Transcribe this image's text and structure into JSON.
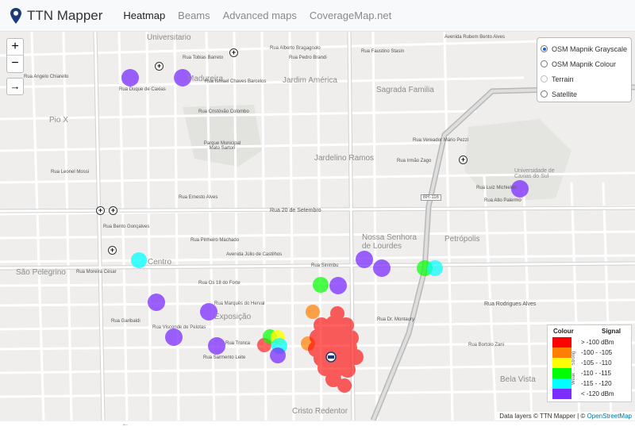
{
  "navbar": {
    "brand": "TTN Mapper",
    "links": [
      "Heatmap",
      "Beams",
      "Advanced maps",
      "CoverageMap.net"
    ]
  },
  "map": {
    "zoom_in": "+",
    "zoom_out": "−",
    "reset": "→",
    "layers": [
      "OSM Mapnik Grayscale",
      "OSM Mapnik Colour",
      "Terrain",
      "Satellite"
    ],
    "selected_layer": "OSM Mapnik Grayscale",
    "districts": [
      "Universitario",
      "Madureira",
      "Jardim América",
      "Sagrada Familia",
      "Pio X",
      "Jardelino Ramos",
      "Universidade de Caxias do Sul",
      "Centro",
      "Nossa Senhora de Lourdes",
      "Petrópolis",
      "São Pelegrino",
      "Exposição",
      "Bela Vista",
      "Cristo Redentor"
    ],
    "streets": [
      "Rua Tobias Barreto",
      "Rua Alberto Bragagnolo",
      "Rua Ismael Chaves Barcelos",
      "Rua Pedro Brandi",
      "Rua Faustino Stasin",
      "Avenida Rubem Bento Alves",
      "Rua Duque de Caxias",
      "Rua Cristóvão Colombo",
      "Parque Municipal Mato Sartori",
      "Rua Ernesto Alves",
      "Rua 20 de Setembro",
      "Rua Bento Gonçalves",
      "Rua Pinheiro Machado",
      "Avenida Júlio de Castilhos",
      "Rua Sinimbu",
      "Rua Os 18 do Forte",
      "Rua Marquês do Herval",
      "Rua Dr. Montaury",
      "Rua Garibaldi",
      "Rua Visconde de Pelotas",
      "Rua Moreira César",
      "Rua Tronca",
      "Rua Sarmento Leite",
      "Rua Bortolo Zani",
      "Rua Irmão Zago",
      "Rua Rodrigues Alves",
      "Rua Angelo Chiarello",
      "Rua Leonel Mossi",
      "Rua Luiz Michielon",
      "Rua Alto Palermo",
      "Rua Vereador Mário Pezzi",
      "BR-116"
    ],
    "attribution_prefix": "Data layers © TTN Mapper | ©",
    "attribution_link": "OpenStreetMap",
    "blue_colour": "#7b2cff"
  },
  "legend": {
    "col_colour": "Colour",
    "col_signal": "Signal",
    "weak_label": "Weak",
    "strong_label": "Strong",
    "rows": [
      {
        "color": "#ff0000",
        "label": "> -100 dBm"
      },
      {
        "color": "#ff7f00",
        "label": "-100 - -105"
      },
      {
        "color": "#ffff00",
        "label": "-105 - -110"
      },
      {
        "color": "#00ff00",
        "label": "-110 - -115"
      },
      {
        "color": "#00ffff",
        "label": "-115 - -120"
      },
      {
        "color": "#7b2cff",
        "label": "< -120 dBm"
      }
    ]
  },
  "footer": {
    "arrow": "←"
  }
}
